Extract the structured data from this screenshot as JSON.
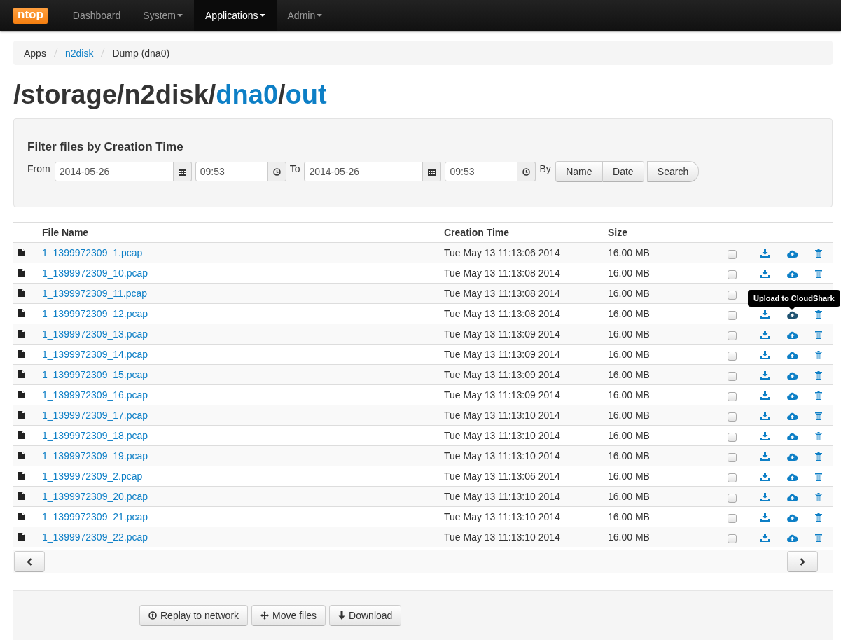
{
  "navbar": {
    "brand": "ntop",
    "items": [
      {
        "label": "Dashboard",
        "dropdown": false,
        "selected": false
      },
      {
        "label": "System",
        "dropdown": true,
        "selected": false
      },
      {
        "label": "Applications",
        "dropdown": true,
        "selected": true
      },
      {
        "label": "Admin",
        "dropdown": true,
        "selected": false
      }
    ]
  },
  "breadcrumb": [
    {
      "label": "Apps",
      "link": false
    },
    {
      "label": "n2disk",
      "link": true
    },
    {
      "label": "Dump (dna0)",
      "link": false
    }
  ],
  "heading": [
    {
      "text": "/storage/n2disk/",
      "link": false
    },
    {
      "text": "dna0",
      "link": true
    },
    {
      "text": "/",
      "link": false
    },
    {
      "text": "out",
      "link": true
    }
  ],
  "filter": {
    "title": "Filter files by Creation Time",
    "from_label": "From",
    "from_date": "2014-05-26",
    "from_time": "09:53",
    "to_label": "To",
    "to_date": "2014-05-26",
    "to_time": "09:53",
    "by_label": "By",
    "sort_buttons": [
      "Name",
      "Date"
    ],
    "search_button": "Search"
  },
  "table": {
    "columns": [
      "File Name",
      "Creation Time",
      "Size"
    ],
    "rows": [
      {
        "name": "1_1399972309_1.pcap",
        "time": "Tue May 13 11:13:06 2014",
        "size": "16.00 MB",
        "checked": false
      },
      {
        "name": "1_1399972309_10.pcap",
        "time": "Tue May 13 11:13:08 2014",
        "size": "16.00 MB",
        "checked": false
      },
      {
        "name": "1_1399972309_11.pcap",
        "time": "Tue May 13 11:13:08 2014",
        "size": "16.00 MB",
        "checked": false
      },
      {
        "name": "1_1399972309_12.pcap",
        "time": "Tue May 13 11:13:08 2014",
        "size": "16.00 MB",
        "checked": false,
        "upload_tooltip": "Upload to CloudShark"
      },
      {
        "name": "1_1399972309_13.pcap",
        "time": "Tue May 13 11:13:09 2014",
        "size": "16.00 MB",
        "checked": false
      },
      {
        "name": "1_1399972309_14.pcap",
        "time": "Tue May 13 11:13:09 2014",
        "size": "16.00 MB",
        "checked": false
      },
      {
        "name": "1_1399972309_15.pcap",
        "time": "Tue May 13 11:13:09 2014",
        "size": "16.00 MB",
        "checked": false
      },
      {
        "name": "1_1399972309_16.pcap",
        "time": "Tue May 13 11:13:09 2014",
        "size": "16.00 MB",
        "checked": false
      },
      {
        "name": "1_1399972309_17.pcap",
        "time": "Tue May 13 11:13:10 2014",
        "size": "16.00 MB",
        "checked": false
      },
      {
        "name": "1_1399972309_18.pcap",
        "time": "Tue May 13 11:13:10 2014",
        "size": "16.00 MB",
        "checked": false
      },
      {
        "name": "1_1399972309_19.pcap",
        "time": "Tue May 13 11:13:10 2014",
        "size": "16.00 MB",
        "checked": false
      },
      {
        "name": "1_1399972309_2.pcap",
        "time": "Tue May 13 11:13:06 2014",
        "size": "16.00 MB",
        "checked": false
      },
      {
        "name": "1_1399972309_20.pcap",
        "time": "Tue May 13 11:13:10 2014",
        "size": "16.00 MB",
        "checked": false
      },
      {
        "name": "1_1399972309_21.pcap",
        "time": "Tue May 13 11:13:10 2014",
        "size": "16.00 MB",
        "checked": false
      },
      {
        "name": "1_1399972309_22.pcap",
        "time": "Tue May 13 11:13:10 2014",
        "size": "16.00 MB",
        "checked": false
      }
    ]
  },
  "actions": [
    {
      "kind": "replay",
      "label": "Replay to network"
    },
    {
      "kind": "move",
      "label": "Move files"
    },
    {
      "kind": "download",
      "label": "Download"
    }
  ]
}
